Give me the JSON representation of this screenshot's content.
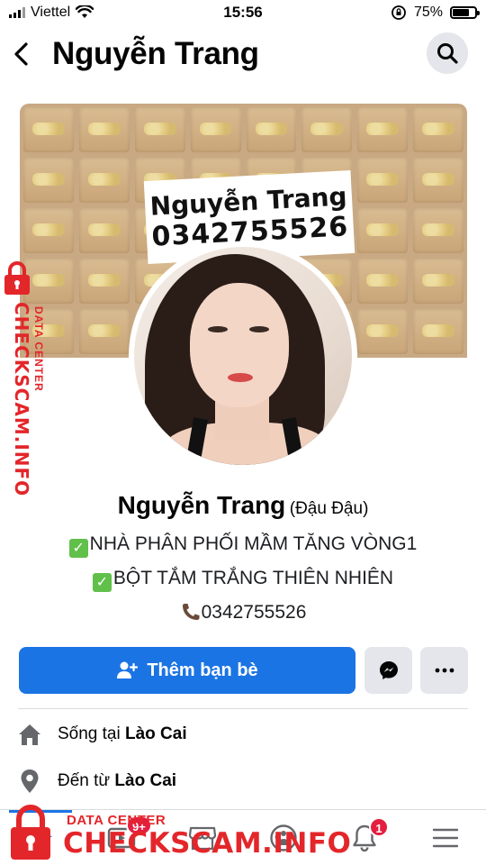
{
  "status_bar": {
    "carrier": "Viettel",
    "time": "15:56",
    "battery": "75%",
    "battery_level": 0.75
  },
  "header": {
    "title": "Nguyễn Trang"
  },
  "cover": {
    "label_name": "Nguyễn Trang",
    "label_phone": "0342755526"
  },
  "profile": {
    "name": "Nguyễn Trang",
    "alternate_name": "(Đậu Đậu)",
    "bio": [
      "NHÀ PHÂN PHỐI MẦM TĂNG VÒNG1",
      "BỘT TẮM TRẮNG THIÊN NHIÊN",
      "0342755526"
    ]
  },
  "actions": {
    "add_friend_label": "Thêm bạn bè"
  },
  "info": {
    "lives_in_prefix": "Sống tại ",
    "lives_in_value": "Lào Cai",
    "from_prefix": "Đến từ ",
    "from_value": "Lào Cai"
  },
  "bottom_nav": {
    "items": [
      {
        "icon": "home-icon",
        "active": true
      },
      {
        "icon": "watch-icon",
        "badge": "9+"
      },
      {
        "icon": "marketplace-icon"
      },
      {
        "icon": "groups-icon"
      },
      {
        "icon": "bell-icon",
        "badge": "1"
      },
      {
        "icon": "menu-icon"
      }
    ]
  },
  "watermark": {
    "side_text": "CHECKSCAM.INFO",
    "side_sub": "DATA CENTER",
    "bottom_sub": "DATA CENTER",
    "bottom_text": "CHECKSCAM.INFO"
  },
  "colors": {
    "accent": "#1b74e4",
    "watermark": "#e3262a",
    "badge": "#e41e3f"
  }
}
